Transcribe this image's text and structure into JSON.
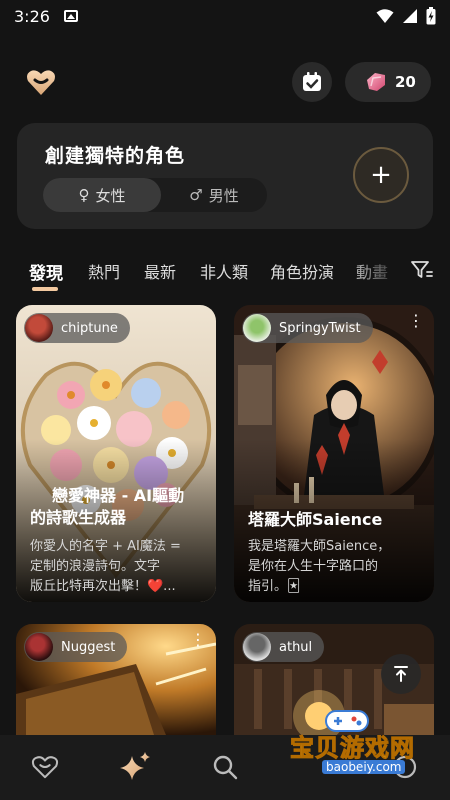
{
  "status_bar": {
    "time": "3:26"
  },
  "header": {
    "gems_count": "20"
  },
  "create_card": {
    "title": "創建獨特的角色",
    "female_label": "女性",
    "male_label": "男性",
    "plus_label": "+"
  },
  "tabs": [
    "發現",
    "熱門",
    "最新",
    "非人類",
    "角色扮演",
    "動畫"
  ],
  "cards": [
    {
      "author": "chiptune",
      "title_lines": [
        "戀愛神器 - AI驅動",
        "的詩歌生成器"
      ],
      "desc_lines": [
        "你愛人的名字 + AI魔法 =",
        "定制的浪漫詩句。文字",
        "版丘比特再次出擊！❤️..."
      ]
    },
    {
      "author": "SpringyTwist",
      "title_lines": [
        "塔羅大師Saience"
      ],
      "desc_lines": [
        "我是塔羅大師Saience，",
        "是你在人生十字路口的",
        "指引。🃏"
      ]
    },
    {
      "author": "Nuggest"
    },
    {
      "author": "athul"
    }
  ],
  "watermark": {
    "text": "宝贝游戏网",
    "url": "baobeiy.com"
  },
  "colors": {
    "accent": "#f3c9a0",
    "background": "#141414",
    "card": "#252525"
  }
}
